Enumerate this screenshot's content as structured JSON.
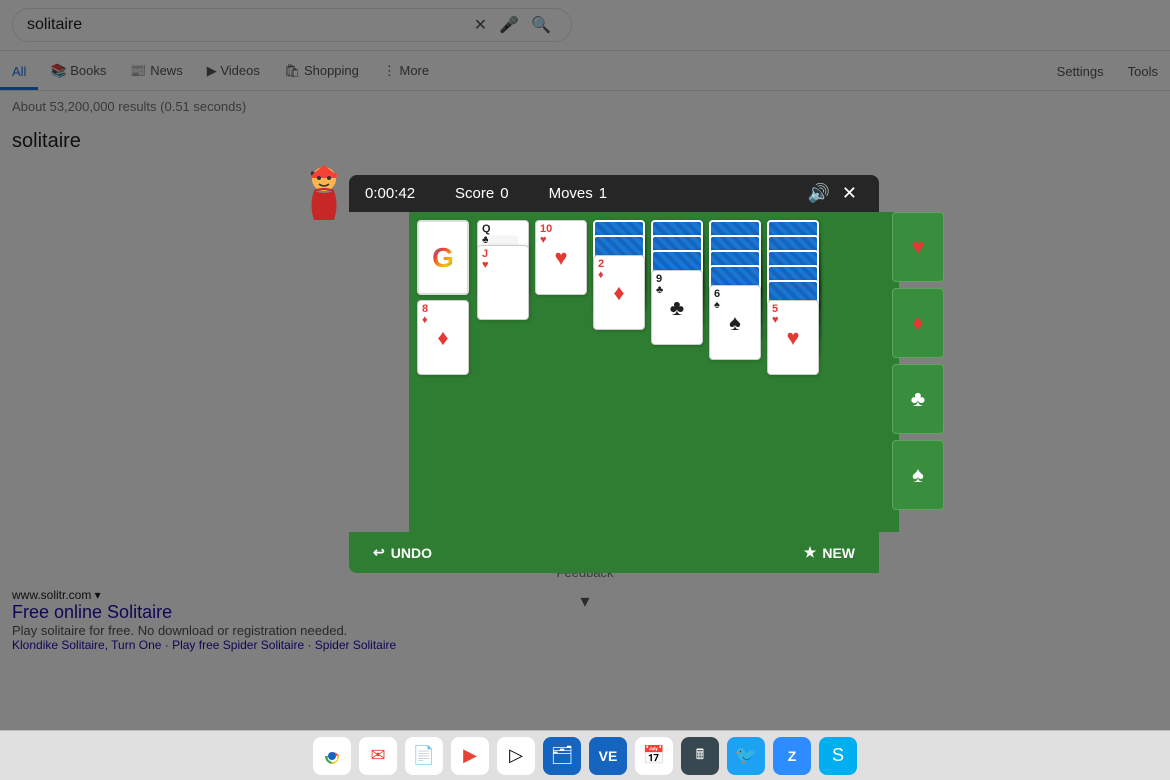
{
  "search": {
    "query": "solitaire",
    "results_count": "About 53,200,000 results (0.51 seconds)",
    "clear_icon": "×",
    "mic_icon": "🎤",
    "search_icon": "🔍"
  },
  "nav": {
    "tabs": [
      {
        "label": "All",
        "active": true
      },
      {
        "label": "Books",
        "active": false
      },
      {
        "label": "News",
        "active": false
      },
      {
        "label": "Videos",
        "active": false
      },
      {
        "label": "Shopping",
        "active": false
      },
      {
        "label": "More",
        "active": false
      }
    ],
    "settings": "Settings",
    "tools": "Tools"
  },
  "page_title": "solitaire",
  "game": {
    "timer": "0:00:42",
    "score_label": "Score",
    "score_value": "0",
    "moves_label": "Moves",
    "moves_value": "1",
    "undo_label": "UNDO",
    "new_label": "NEW"
  },
  "foundation": {
    "suits": [
      "♥",
      "♦",
      "♣",
      "♠"
    ]
  },
  "search_result": {
    "url": "www.solitr.com ▾",
    "title": "Free online Solitaire",
    "description": "Play solitaire for free. No download or registration needed.",
    "links": "Klondike Solitaire, Turn One · Play free Spider Solitaire · Spider Solitaire"
  },
  "taskbar_icons": [
    "chrome",
    "mail",
    "docs",
    "youtube",
    "play",
    "files",
    "ve",
    "calendar",
    "calc",
    "twitter",
    "zoom",
    "skype"
  ],
  "feedback": "Feedback"
}
